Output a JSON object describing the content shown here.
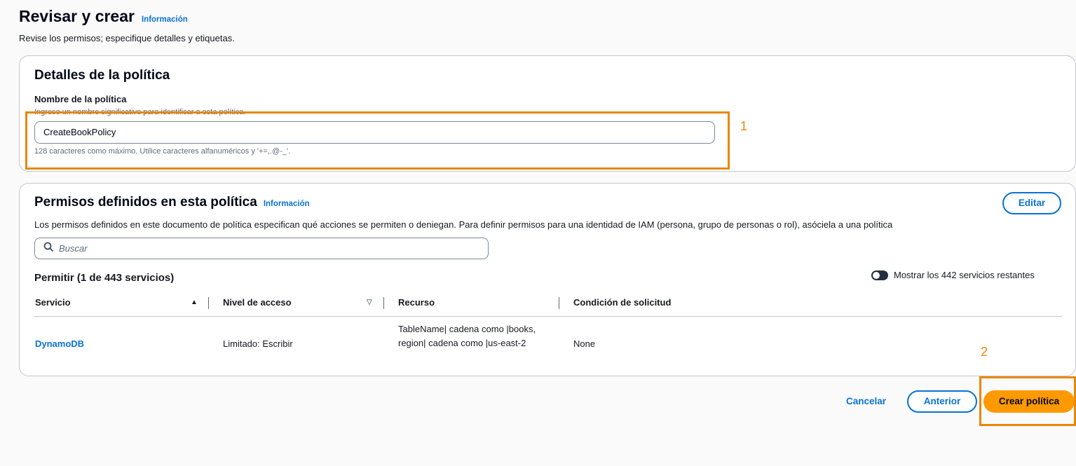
{
  "header": {
    "title": "Revisar y crear",
    "info_link": "Información",
    "description": "Revise los permisos; especifique detalles y etiquetas."
  },
  "policy_details": {
    "title": "Detalles de la política",
    "name_label": "Nombre de la política",
    "name_description": "Ingrese un nombre significativo para identificar a esta política.",
    "name_value": "CreateBookPolicy",
    "name_hint": "128 caracteres como máximo. Utilice caracteres alfanuméricos y '+=,.@-_'."
  },
  "permissions": {
    "title": "Permisos definidos en esta política",
    "info_link": "Información",
    "edit_label": "Editar",
    "description": "Los permisos definidos en este documento de política especifican qué acciones se permiten o deniegan. Para definir permisos para una identidad de IAM (persona, grupo de personas o rol), asóciela a una política",
    "search_placeholder": "Buscar",
    "allow_title": "Permitir (1 de 443 servicios)",
    "toggle_label": "Mostrar los 442 servicios restantes",
    "columns": {
      "service": "Servicio",
      "access_level": "Nivel de acceso",
      "resource": "Recurso",
      "condition": "Condición de solicitud"
    },
    "rows": [
      {
        "service": "DynamoDB",
        "access_level": "Limitado: Escribir",
        "resource": "TableName| cadena como |books, region| cadena como |us-east-2",
        "condition": "None"
      }
    ]
  },
  "footer": {
    "cancel_label": "Cancelar",
    "previous_label": "Anterior",
    "create_label": "Crear política"
  },
  "annotations": {
    "label_1": "1",
    "label_2": "2"
  },
  "colors": {
    "accent": "#0972d3",
    "primary_button": "#ff9900",
    "annotation": "#e8870a"
  }
}
